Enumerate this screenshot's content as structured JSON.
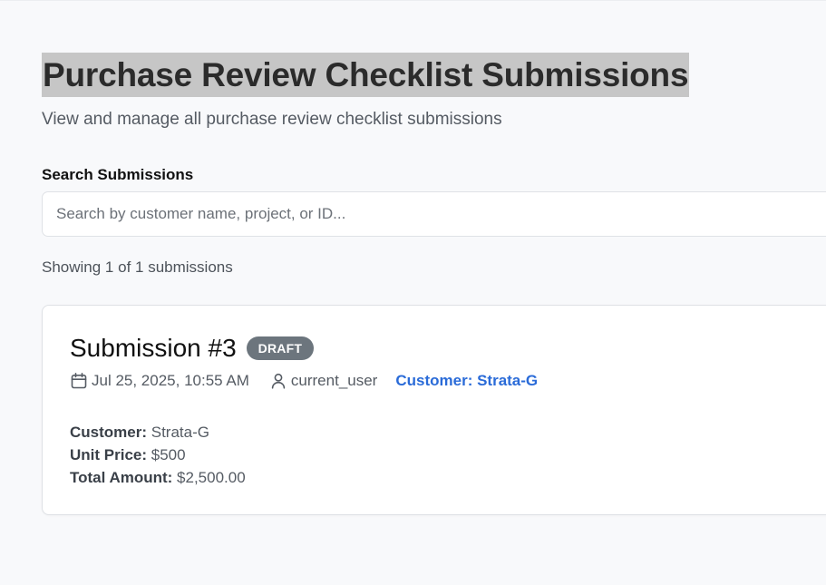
{
  "header": {
    "title": "Purchase Review Checklist Submissions",
    "subtitle": "View and manage all purchase review checklist submissions"
  },
  "search": {
    "label": "Search Submissions",
    "placeholder": "Search by customer name, project, or ID...",
    "value": ""
  },
  "results": {
    "count_text": "Showing 1 of 1 submissions"
  },
  "submissions": [
    {
      "title": "Submission #3",
      "status": "DRAFT",
      "date": "Jul 25, 2025, 10:55 AM",
      "date_icon": "calendar-icon",
      "user": "current_user",
      "user_icon": "user-icon",
      "customer_link": "Customer: Strata-G",
      "details": [
        {
          "key": "Customer:",
          "value": "Strata-G"
        },
        {
          "key": "Unit Price:",
          "value": "$500"
        },
        {
          "key": "Total Amount:",
          "value": "$2,500.00"
        }
      ]
    }
  ],
  "colors": {
    "background": "#f8f9fb",
    "title_highlight": "#c6c6c6",
    "badge": "#6c757d",
    "link": "#2a6bd8"
  }
}
